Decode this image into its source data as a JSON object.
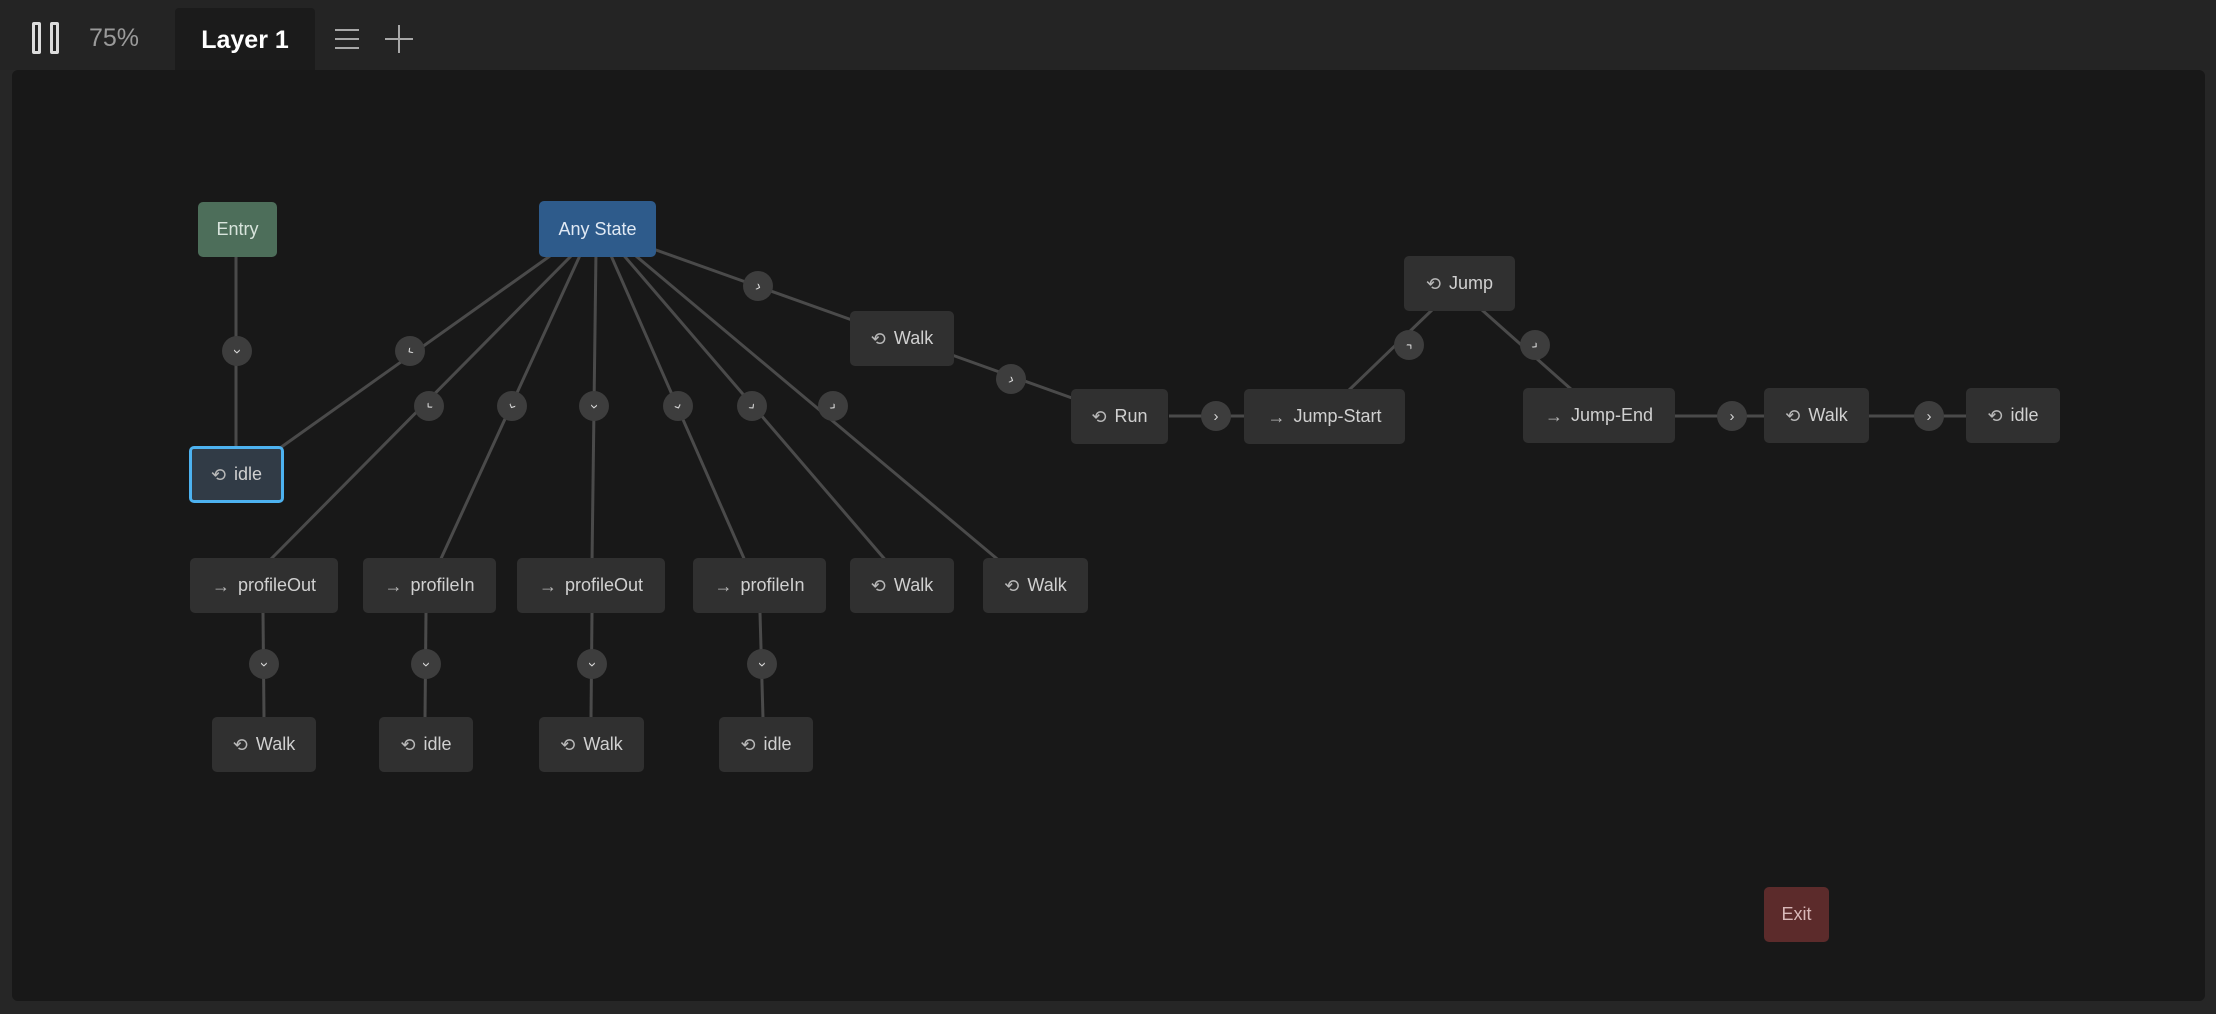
{
  "toolbar": {
    "zoom": "75%",
    "tab_label": "Layer 1"
  },
  "icons": {
    "loop": "⟲",
    "arrow": "→"
  },
  "nodes": {
    "entry": "Entry",
    "any_state": "Any State",
    "idle_main": "idle",
    "walk_top": "Walk",
    "run": "Run",
    "jump_start": "Jump-Start",
    "jump": "Jump",
    "jump_end": "Jump-End",
    "walk_after_jump": "Walk",
    "idle_end": "idle",
    "profile_out_1": "profileOut",
    "profile_in_1": "profileIn",
    "profile_out_2": "profileOut",
    "profile_in_2": "profileIn",
    "walk_mid_1": "Walk",
    "walk_mid_2": "Walk",
    "walk_bottom_1": "Walk",
    "idle_bottom_1": "idle",
    "walk_bottom_2": "Walk",
    "idle_bottom_2": "idle",
    "exit": "Exit"
  },
  "colors": {
    "entry": "#4d6e5a",
    "any_state": "#2e5b8b",
    "exit": "#5c2b2b",
    "state": "#303030",
    "selected_border": "#4db2f0",
    "canvas": "#181818"
  }
}
